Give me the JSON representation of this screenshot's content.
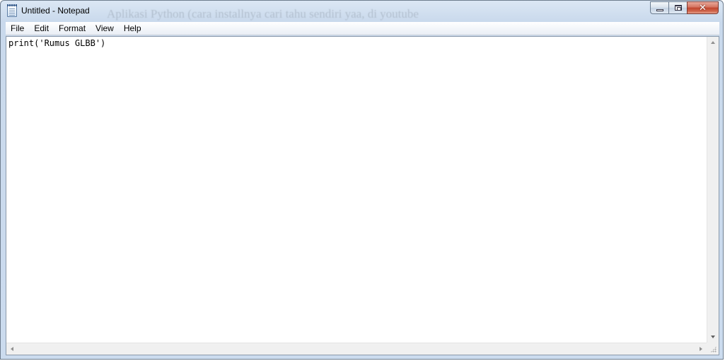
{
  "window": {
    "title": "Untitled - Notepad",
    "background_text": "Aplikasi Python (cara installnya cari tahu sendiri yaa, di youtube"
  },
  "menu": {
    "items": [
      {
        "label": "File"
      },
      {
        "label": "Edit"
      },
      {
        "label": "Format"
      },
      {
        "label": "View"
      },
      {
        "label": "Help"
      }
    ]
  },
  "editor": {
    "content": "print('Rumus GLBB')"
  },
  "icons": {
    "app": "notepad-icon",
    "minimize": "minimize-icon",
    "maximize": "maximize-icon",
    "close": "close-icon"
  },
  "colors": {
    "frame": "#cbdbee",
    "close_button": "#c0462f"
  }
}
